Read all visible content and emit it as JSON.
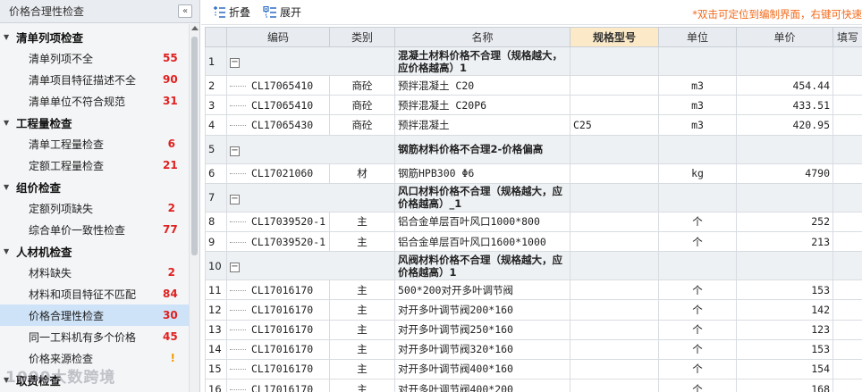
{
  "left_panel": {
    "title": "价格合理性检查",
    "collapse_label": "«",
    "groups": [
      {
        "label": "清单列项检查",
        "items": [
          {
            "label": "清单列项不全",
            "count": "55"
          },
          {
            "label": "清单项目特征描述不全",
            "count": "90"
          },
          {
            "label": "清单单位不符合规范",
            "count": "31"
          }
        ]
      },
      {
        "label": "工程量检查",
        "items": [
          {
            "label": "清单工程量检查",
            "count": "6"
          },
          {
            "label": "定额工程量检查",
            "count": "21"
          }
        ]
      },
      {
        "label": "组价检查",
        "items": [
          {
            "label": "定额列项缺失",
            "count": "2"
          },
          {
            "label": "综合单价一致性检查",
            "count": "77"
          }
        ]
      },
      {
        "label": "人材机检查",
        "items": [
          {
            "label": "材料缺失",
            "count": "2"
          },
          {
            "label": "材料和项目特征不匹配",
            "count": "84"
          },
          {
            "label": "价格合理性检查",
            "count": "30",
            "selected": true
          },
          {
            "label": "同一工料机有多个价格",
            "count": "45"
          },
          {
            "label": "价格来源检查",
            "count": "!"
          }
        ]
      },
      {
        "label": "取费检查",
        "items": []
      }
    ],
    "watermark": "1000大数跨境"
  },
  "toolbar": {
    "collapse_label": "折叠",
    "expand_label": "展开",
    "hint": "*双击可定位到编制界面，右键可快速"
  },
  "table": {
    "headers": [
      "",
      "编码",
      "类别",
      "名称",
      "规格型号",
      "单位",
      "单价",
      "填写"
    ],
    "rows": [
      {
        "type": "group",
        "no": "1",
        "name": "混凝土材料价格不合理（规格越大，应价格越高）1"
      },
      {
        "type": "item",
        "no": "2",
        "code": "CL17065410",
        "cat": "商砼",
        "name": "预拌混凝土 C20",
        "spec": "",
        "unit": "m3",
        "price": "454.44"
      },
      {
        "type": "item",
        "no": "3",
        "code": "CL17065410",
        "cat": "商砼",
        "name": "预拌混凝土 C20P6",
        "spec": "",
        "unit": "m3",
        "price": "433.51"
      },
      {
        "type": "item",
        "no": "4",
        "code": "CL17065430",
        "cat": "商砼",
        "name": "预拌混凝土",
        "spec": "C25",
        "unit": "m3",
        "price": "420.95"
      },
      {
        "type": "group",
        "no": "5",
        "name": "钢筋材料价格不合理2-价格偏高"
      },
      {
        "type": "item",
        "no": "6",
        "code": "CL17021060",
        "cat": "材",
        "name": "钢筋HPB300 Φ6",
        "spec": "",
        "unit": "kg",
        "price": "4790"
      },
      {
        "type": "group",
        "no": "7",
        "name": "风口材料价格不合理（规格越大，应价格越高）_1"
      },
      {
        "type": "item",
        "no": "8",
        "code": "CL17039520-1",
        "cat": "主",
        "name": "铝合金单层百叶风口1000*800",
        "spec": "",
        "unit": "个",
        "price": "252"
      },
      {
        "type": "item",
        "no": "9",
        "code": "CL17039520-1",
        "cat": "主",
        "name": "铝合金单层百叶风口1600*1000",
        "spec": "",
        "unit": "个",
        "price": "213"
      },
      {
        "type": "group",
        "no": "10",
        "name": "风阀材料价格不合理（规格越大，应价格越高）1"
      },
      {
        "type": "item",
        "no": "11",
        "code": "CL17016170",
        "cat": "主",
        "name": "500*200对开多叶调节阀",
        "spec": "",
        "unit": "个",
        "price": "153"
      },
      {
        "type": "item",
        "no": "12",
        "code": "CL17016170",
        "cat": "主",
        "name": "对开多叶调节阀200*160",
        "spec": "",
        "unit": "个",
        "price": "142"
      },
      {
        "type": "item",
        "no": "13",
        "code": "CL17016170",
        "cat": "主",
        "name": "对开多叶调节阀250*160",
        "spec": "",
        "unit": "个",
        "price": "123"
      },
      {
        "type": "item",
        "no": "14",
        "code": "CL17016170",
        "cat": "主",
        "name": "对开多叶调节阀320*160",
        "spec": "",
        "unit": "个",
        "price": "153"
      },
      {
        "type": "item",
        "no": "15",
        "code": "CL17016170",
        "cat": "主",
        "name": "对开多叶调节阀400*160",
        "spec": "",
        "unit": "个",
        "price": "154"
      },
      {
        "type": "item",
        "no": "16",
        "code": "CL17016170",
        "cat": "主",
        "name": "对开多叶调节阀400*200",
        "spec": "",
        "unit": "个",
        "price": "168"
      }
    ]
  },
  "colors": {
    "accent_red": "#e02020",
    "hint_orange": "#f26a1b",
    "selected_bg": "#cfe3f8",
    "active_header": "#fbe9c8"
  }
}
